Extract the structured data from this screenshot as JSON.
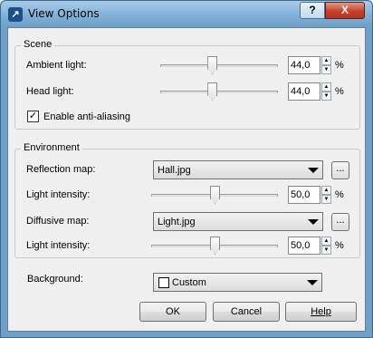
{
  "window": {
    "title": "View Options",
    "help_glyph": "?",
    "close_glyph": "X",
    "app_icon": "app-logo-icon"
  },
  "scene": {
    "group_label": "Scene",
    "ambient": {
      "label": "Ambient light:",
      "value": "44,0",
      "unit": "%",
      "level_percent": 44
    },
    "head": {
      "label": "Head light:",
      "value": "44,0",
      "unit": "%",
      "level_percent": 44
    },
    "antialias": {
      "label": "Enable anti-aliasing",
      "checked": true
    }
  },
  "environment": {
    "group_label": "Environment",
    "reflection": {
      "label": "Reflection map:",
      "selected": "Hall.jpg",
      "browse_label": "...",
      "intensity_label": "Light intensity:",
      "intensity_value": "50,0",
      "unit": "%",
      "level_percent": 50
    },
    "diffusive": {
      "label": "Diffusive map:",
      "selected": "Light.jpg",
      "browse_label": "...",
      "intensity_label": "Light intensity:",
      "intensity_value": "50,0",
      "unit": "%",
      "level_percent": 50
    }
  },
  "background": {
    "label": "Background:",
    "selected": "Custom"
  },
  "buttons": {
    "ok": "OK",
    "cancel": "Cancel",
    "help": "Help"
  }
}
